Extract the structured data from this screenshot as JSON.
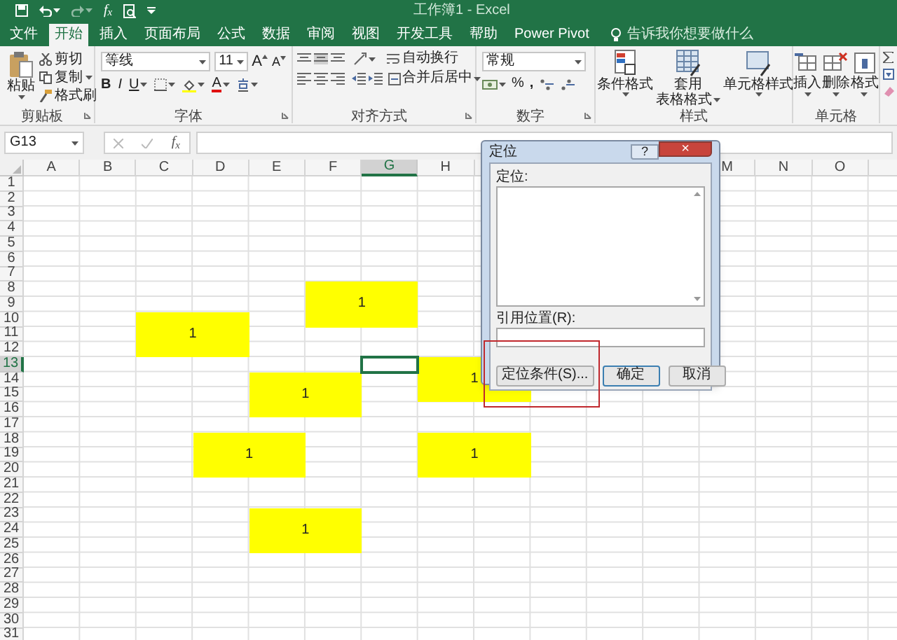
{
  "title_bar": {
    "title": "工作簿1 - Excel",
    "function_button": "f$_{x}$"
  },
  "ribbon_tabs": [
    {
      "label": "文件",
      "selected": false
    },
    {
      "label": "开始",
      "selected": true
    },
    {
      "label": "插入",
      "selected": false
    },
    {
      "label": "页面布局",
      "selected": false
    },
    {
      "label": "公式",
      "selected": false
    },
    {
      "label": "数据",
      "selected": false
    },
    {
      "label": "审阅",
      "selected": false
    },
    {
      "label": "视图",
      "selected": false
    },
    {
      "label": "开发工具",
      "selected": false
    },
    {
      "label": "帮助",
      "selected": false
    },
    {
      "label": "Power Pivot",
      "selected": false
    }
  ],
  "tell_me": {
    "placeholder": "告诉我你想要做什么"
  },
  "clipboard": {
    "paste": "粘贴",
    "cut": "剪切",
    "copy": "复制",
    "format_painter": "格式刷",
    "label": "剪贴板"
  },
  "font": {
    "font_name": "等线",
    "font_size": "11",
    "grow_font": "A",
    "shrink_font": "A",
    "bold": "B",
    "italic": "I",
    "underline": "U",
    "font_color": "A",
    "label": "字体"
  },
  "alignment": {
    "wrap_text": "自动换行",
    "merge_center": "合并后居中",
    "label": "对齐方式"
  },
  "number": {
    "format": "常规",
    "percent": "%",
    "comma": ",",
    "label": "数字"
  },
  "styles": {
    "buttons": [
      {
        "lines": [
          "条件格式"
        ]
      },
      {
        "lines": [
          "套用",
          "表格格式"
        ]
      },
      {
        "lines": [
          "单元格样式"
        ]
      }
    ],
    "label": "样式"
  },
  "cells": {
    "buttons": [
      "插入",
      "删除",
      "格式"
    ],
    "label": "单元格"
  },
  "formula_bar": {
    "name_box": "G13",
    "function_button": "f$_{x}$"
  },
  "sheet": {
    "columns": [
      {
        "label": "A",
        "selected": false
      },
      {
        "label": "B",
        "selected": false
      },
      {
        "label": "C",
        "selected": false
      },
      {
        "label": "D",
        "selected": false
      },
      {
        "label": "E",
        "selected": false
      },
      {
        "label": "F",
        "selected": false
      },
      {
        "label": "G",
        "selected": true
      },
      {
        "label": "H",
        "selected": false
      },
      {
        "label": "M",
        "selected": false
      },
      {
        "label": "N",
        "selected": false
      },
      {
        "label": "O",
        "selected": false
      }
    ],
    "rows": [
      {
        "label": "1",
        "selected": false
      },
      {
        "label": "2",
        "selected": false
      },
      {
        "label": "3",
        "selected": false
      },
      {
        "label": "4",
        "selected": false
      },
      {
        "label": "5",
        "selected": false
      },
      {
        "label": "6",
        "selected": false
      },
      {
        "label": "7",
        "selected": false
      },
      {
        "label": "8",
        "selected": false
      },
      {
        "label": "9",
        "selected": false
      },
      {
        "label": "10",
        "selected": false
      },
      {
        "label": "11",
        "selected": false
      },
      {
        "label": "12",
        "selected": false
      },
      {
        "label": "13",
        "selected": true
      },
      {
        "label": "14",
        "selected": false
      },
      {
        "label": "15",
        "selected": false
      },
      {
        "label": "16",
        "selected": false
      },
      {
        "label": "17",
        "selected": false
      },
      {
        "label": "18",
        "selected": false
      },
      {
        "label": "19",
        "selected": false
      },
      {
        "label": "20",
        "selected": false
      },
      {
        "label": "21",
        "selected": false
      },
      {
        "label": "22",
        "selected": false
      },
      {
        "label": "23",
        "selected": false
      },
      {
        "label": "24",
        "selected": false
      },
      {
        "label": "25",
        "selected": false
      },
      {
        "label": "26",
        "selected": false
      },
      {
        "label": "27",
        "selected": false
      },
      {
        "label": "28",
        "selected": false
      },
      {
        "label": "29",
        "selected": false
      },
      {
        "label": "30",
        "selected": false
      },
      {
        "label": "31",
        "selected": false
      }
    ],
    "merged_cells": [
      {
        "value": "1",
        "color": "#ffff00"
      },
      {
        "value": "1",
        "color": "#ffff00"
      },
      {
        "value": "1",
        "color": "#ffff00"
      },
      {
        "value": "1",
        "color": "#ffff00"
      },
      {
        "value": "1",
        "color": "#ffff00"
      },
      {
        "value": "1",
        "color": "#ffff00"
      },
      {
        "value": "1",
        "color": "#ffff00"
      }
    ]
  },
  "dialog": {
    "title": "定位",
    "help": "?",
    "close": "×",
    "list_label": "定位:",
    "reference_label": "引用位置(R):",
    "buttons": [
      {
        "label": "定位条件(S)...",
        "default": false,
        "highlighted": true
      },
      {
        "label": "确定",
        "default": true,
        "highlighted": false
      },
      {
        "label": "取消",
        "default": false,
        "highlighted": false
      }
    ]
  }
}
